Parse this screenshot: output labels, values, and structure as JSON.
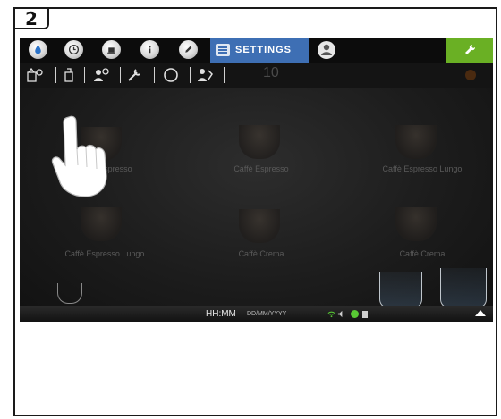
{
  "step": {
    "number": "2"
  },
  "topbar": {
    "icons": [
      "water-drop-icon",
      "clock-icon",
      "cup-icon",
      "info-icon",
      "pencil-icon"
    ],
    "settings_tab_label": "SETTINGS",
    "accent_blue": "#3e6fb4",
    "accent_green": "#6ab024"
  },
  "subbar": {
    "icons": [
      "beans-grinder-icon",
      "brew-unit-icon",
      "service-tools-icon",
      "wrench-icon",
      "circle-icon",
      "milk-system-icon"
    ],
    "counter": "10"
  },
  "beverages": [
    {
      "label": "Caffè Espresso"
    },
    {
      "label": "Caffè Espresso"
    },
    {
      "label": "Caffè Espresso Lungo"
    },
    {
      "label": "Caffè Espresso Lungo"
    },
    {
      "label": "Caffè Crema"
    },
    {
      "label": "Caffè Crema"
    }
  ],
  "statusbar": {
    "time": "HH:MM",
    "date": "DD/MM/YYYY"
  }
}
